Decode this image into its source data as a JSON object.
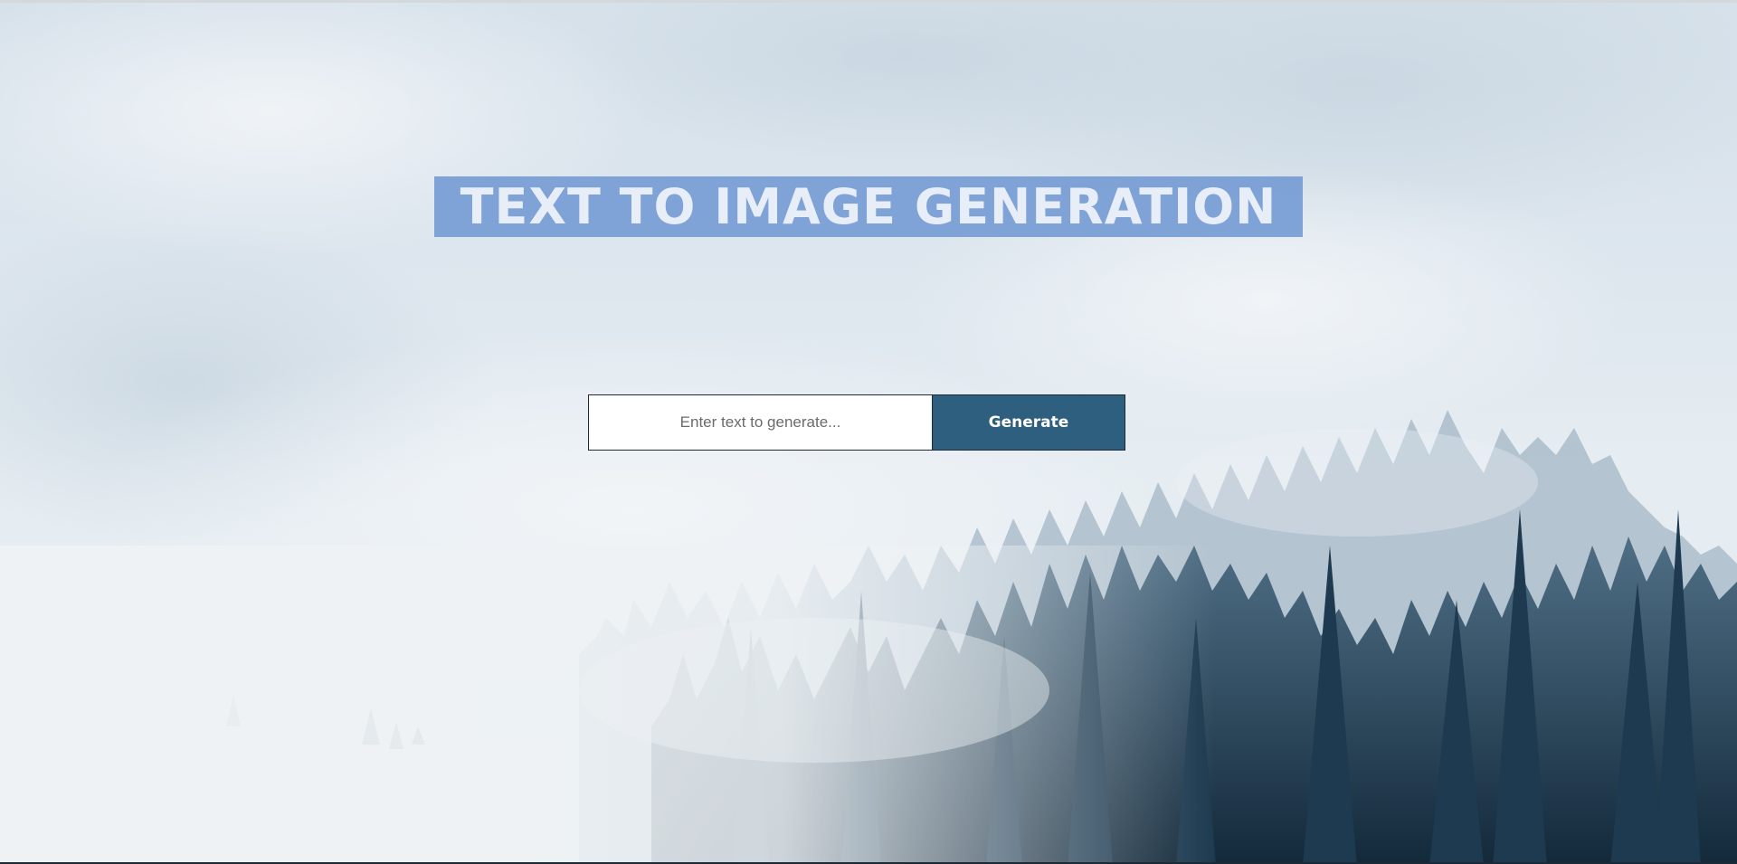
{
  "hero": {
    "title": "TEXT TO IMAGE GENERATION"
  },
  "form": {
    "input_placeholder": "Enter text to generate...",
    "input_value": "",
    "generate_label": "Generate"
  },
  "background": {
    "icon": "misty-forest-image"
  },
  "colors": {
    "banner": "#6e96d2",
    "button": "#2f5f7e",
    "sky": "#dde6ee",
    "forest_dark": "#1d3a50"
  }
}
